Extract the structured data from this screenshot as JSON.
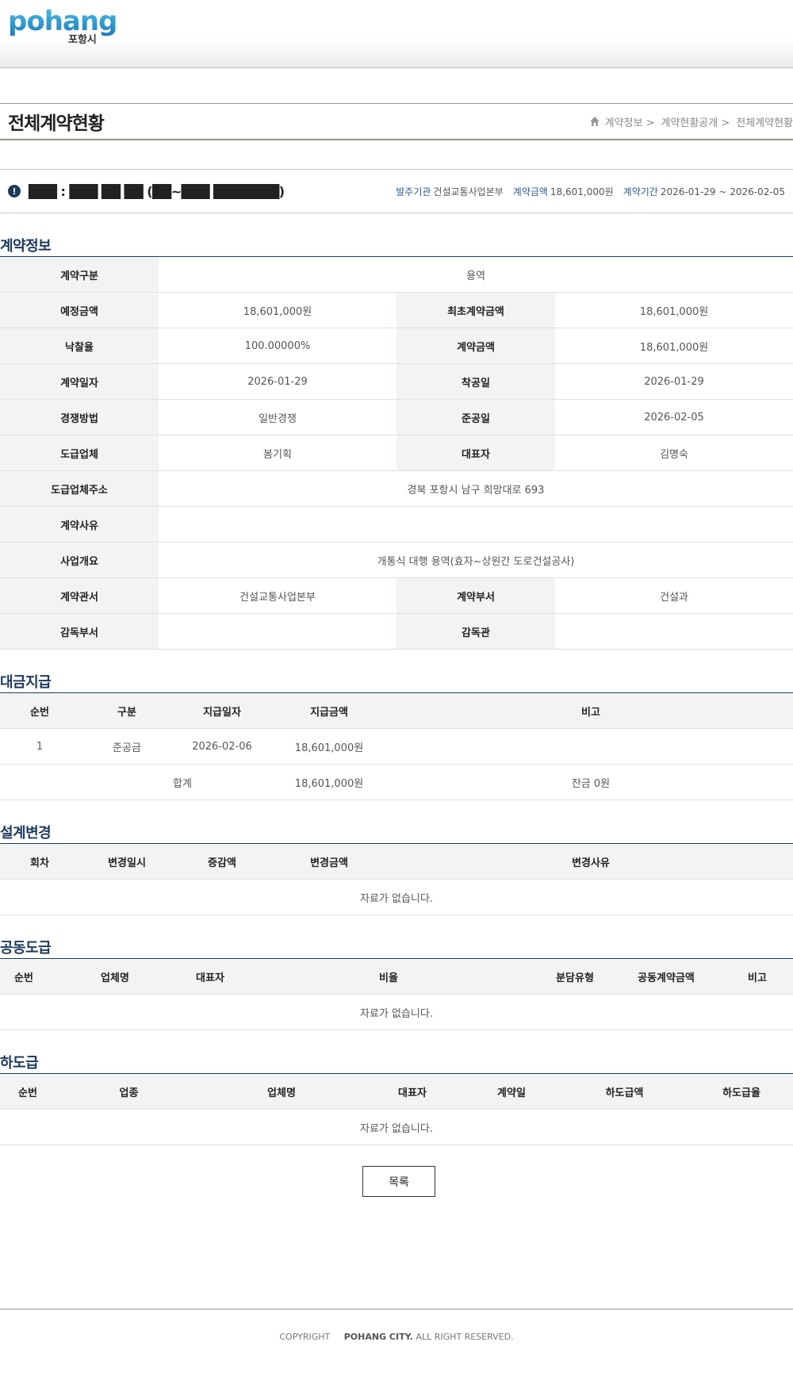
{
  "header": {
    "logo_text": "pohang",
    "logo_sub": "포항시"
  },
  "page": {
    "title": "전체계약현황",
    "breadcrumb": [
      "계약정보 >",
      "계약현황공개 >",
      "전체계약현황"
    ]
  },
  "summary": {
    "contract_name": "███ : ███ ██ ██ (██~███ ███████)",
    "agency_label": "발주기관",
    "agency": "건설교통사업본부",
    "amount_label": "계약금액",
    "amount": "18,601,000원",
    "period_label": "계약기간",
    "period": "2026-01-29 ~ 2026-02-05"
  },
  "contract_info": {
    "title": "계약정보",
    "type_label": "계약구분",
    "type": "용역",
    "est_label": "예정금액",
    "est": "18,601,000원",
    "init_label": "최초계약금액",
    "init": "18,601,000원",
    "rate_label": "낙찰율",
    "rate": "100.00000%",
    "amt_label": "계약금액",
    "amt": "18,601,000원",
    "date_label": "계약일자",
    "date": "2026-01-29",
    "start_label": "착공일",
    "start": "2026-01-29",
    "method_label": "경쟁방법",
    "method": "일반경쟁",
    "end_label": "준공일",
    "end": "2026-02-05",
    "company_label": "도급업체",
    "company": "봄기획",
    "ceo_label": "대표자",
    "ceo": "김명숙",
    "addr_label": "도급업체주소",
    "addr": "경북 포항시 남구 희망대로 693",
    "reason_label": "계약사유",
    "reason": "",
    "overview_label": "사업개요",
    "overview": "개통식 대행 용역(효자~상원간 도로건설공사)",
    "office_label": "계약관서",
    "office": "건설교통사업본부",
    "dept_label": "계약부서",
    "dept": "건설과",
    "sup_dept_label": "감독부서",
    "sup_dept": "",
    "sup_label": "감독관",
    "sup": ""
  },
  "payment": {
    "title": "대금지급",
    "headers": [
      "순번",
      "구분",
      "지급일자",
      "지급금액",
      "비고"
    ],
    "rows": [
      [
        "1",
        "준공금",
        "2026-02-06",
        "18,601,000원",
        ""
      ]
    ],
    "total_label": "합계",
    "total": "18,601,000원",
    "balance": "잔금 0원"
  },
  "design_change": {
    "title": "설계변경",
    "headers": [
      "회차",
      "변경일시",
      "증감액",
      "변경금액",
      "변경사유"
    ],
    "empty": "자료가 없습니다."
  },
  "joint": {
    "title": "공동도급",
    "headers": [
      "순번",
      "업체명",
      "대표자",
      "비율",
      "분담유형",
      "공동계약금액",
      "비고"
    ],
    "empty": "자료가 없습니다."
  },
  "subcontract": {
    "title": "하도급",
    "headers": [
      "순번",
      "업종",
      "업체명",
      "대표자",
      "계약일",
      "하도급액",
      "하도급율"
    ],
    "empty": "자료가 없습니다."
  },
  "buttons": {
    "list": "목록"
  },
  "footer": {
    "copyright": "COPYRIGHT",
    "owner": "POHANG CITY.",
    "rights": " ALL RIGHT RESERVED."
  }
}
